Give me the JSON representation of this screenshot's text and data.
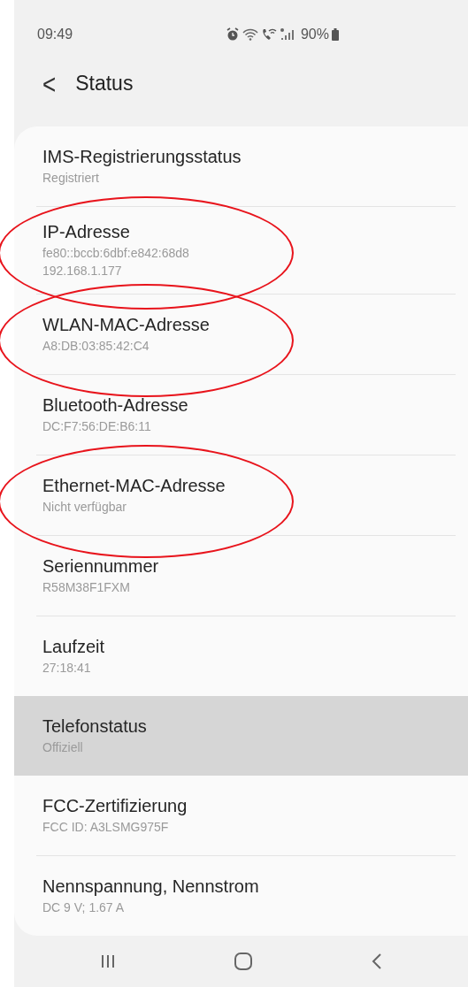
{
  "status_bar": {
    "time": "09:49",
    "battery": "90%"
  },
  "header": {
    "back": "<",
    "title": "Status"
  },
  "items": [
    {
      "title": "IMS-Registrierungsstatus",
      "values": [
        "Registriert"
      ],
      "selected": false,
      "circled": false
    },
    {
      "title": "IP-Adresse",
      "values": [
        "fe80::bccb:6dbf:e842:68d8",
        "192.168.1.177"
      ],
      "selected": false,
      "circled": true
    },
    {
      "title": "WLAN-MAC-Adresse",
      "values": [
        "A8:DB:03:85:42:C4"
      ],
      "selected": false,
      "circled": true
    },
    {
      "title": "Bluetooth-Adresse",
      "values": [
        "DC:F7:56:DE:B6:11"
      ],
      "selected": false,
      "circled": false
    },
    {
      "title": "Ethernet-MAC-Adresse",
      "values": [
        "Nicht verfügbar"
      ],
      "selected": false,
      "circled": true
    },
    {
      "title": "Seriennummer",
      "values": [
        "R58M38F1FXM"
      ],
      "selected": false,
      "circled": false
    },
    {
      "title": "Laufzeit",
      "values": [
        "27:18:41"
      ],
      "selected": false,
      "circled": false
    },
    {
      "title": "Telefonstatus",
      "values": [
        "Offiziell"
      ],
      "selected": true,
      "circled": false
    },
    {
      "title": "FCC-Zertifizierung",
      "values": [
        "FCC ID: A3LSMG975F"
      ],
      "selected": false,
      "circled": false
    },
    {
      "title": "Nennspannung, Nennstrom",
      "values": [
        "DC 9 V; 1.67 A"
      ],
      "selected": false,
      "circled": false
    }
  ]
}
